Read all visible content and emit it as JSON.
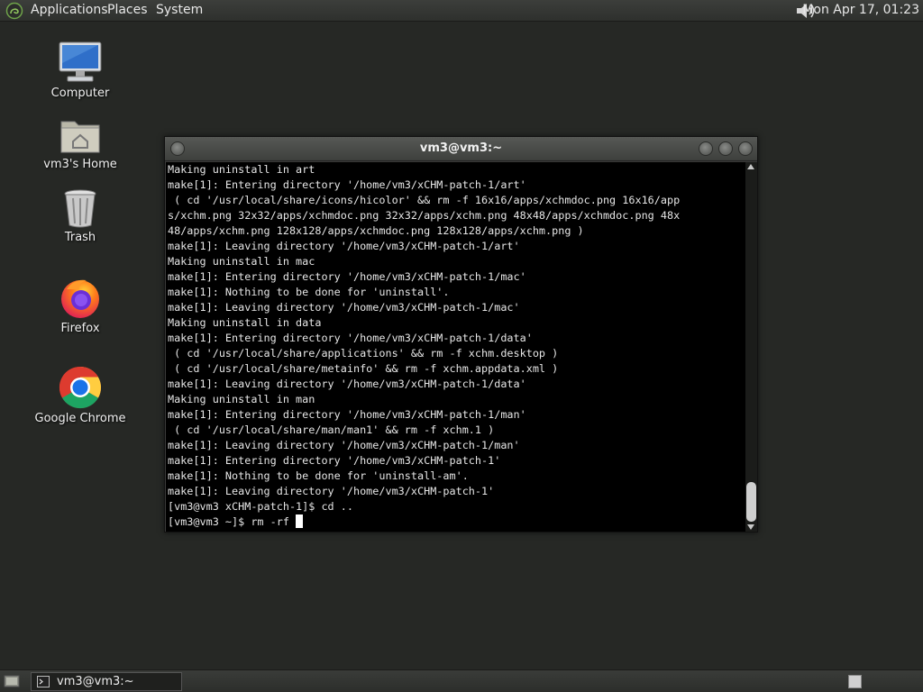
{
  "top_panel": {
    "menus": [
      "Applications",
      "Places",
      "System"
    ],
    "clock": "Mon Apr 17, 01:23"
  },
  "desktop_icons": [
    {
      "label": "Computer",
      "icon": "computer-icon"
    },
    {
      "label": "vm3's Home",
      "icon": "home-folder-icon"
    },
    {
      "label": "Trash",
      "icon": "trash-icon"
    },
    {
      "label": "Firefox",
      "icon": "firefox-icon"
    },
    {
      "label": "Google Chrome",
      "icon": "chrome-icon"
    }
  ],
  "terminal": {
    "title": "vm3@vm3:~",
    "lines": [
      "Making uninstall in art",
      "make[1]: Entering directory '/home/vm3/xCHM-patch-1/art'",
      " ( cd '/usr/local/share/icons/hicolor' && rm -f 16x16/apps/xchmdoc.png 16x16/app",
      "s/xchm.png 32x32/apps/xchmdoc.png 32x32/apps/xchm.png 48x48/apps/xchmdoc.png 48x",
      "48/apps/xchm.png 128x128/apps/xchmdoc.png 128x128/apps/xchm.png )",
      "make[1]: Leaving directory '/home/vm3/xCHM-patch-1/art'",
      "Making uninstall in mac",
      "make[1]: Entering directory '/home/vm3/xCHM-patch-1/mac'",
      "make[1]: Nothing to be done for 'uninstall'.",
      "make[1]: Leaving directory '/home/vm3/xCHM-patch-1/mac'",
      "Making uninstall in data",
      "make[1]: Entering directory '/home/vm3/xCHM-patch-1/data'",
      " ( cd '/usr/local/share/applications' && rm -f xchm.desktop )",
      " ( cd '/usr/local/share/metainfo' && rm -f xchm.appdata.xml )",
      "make[1]: Leaving directory '/home/vm3/xCHM-patch-1/data'",
      "Making uninstall in man",
      "make[1]: Entering directory '/home/vm3/xCHM-patch-1/man'",
      " ( cd '/usr/local/share/man/man1' && rm -f xchm.1 )",
      "make[1]: Leaving directory '/home/vm3/xCHM-patch-1/man'",
      "make[1]: Entering directory '/home/vm3/xCHM-patch-1'",
      "make[1]: Nothing to be done for 'uninstall-am'.",
      "make[1]: Leaving directory '/home/vm3/xCHM-patch-1'",
      "[vm3@vm3 xCHM-patch-1]$ cd .."
    ],
    "prompt": "[vm3@vm3 ~]$ rm -rf "
  },
  "bottom_panel": {
    "task_label": "vm3@vm3:~"
  }
}
